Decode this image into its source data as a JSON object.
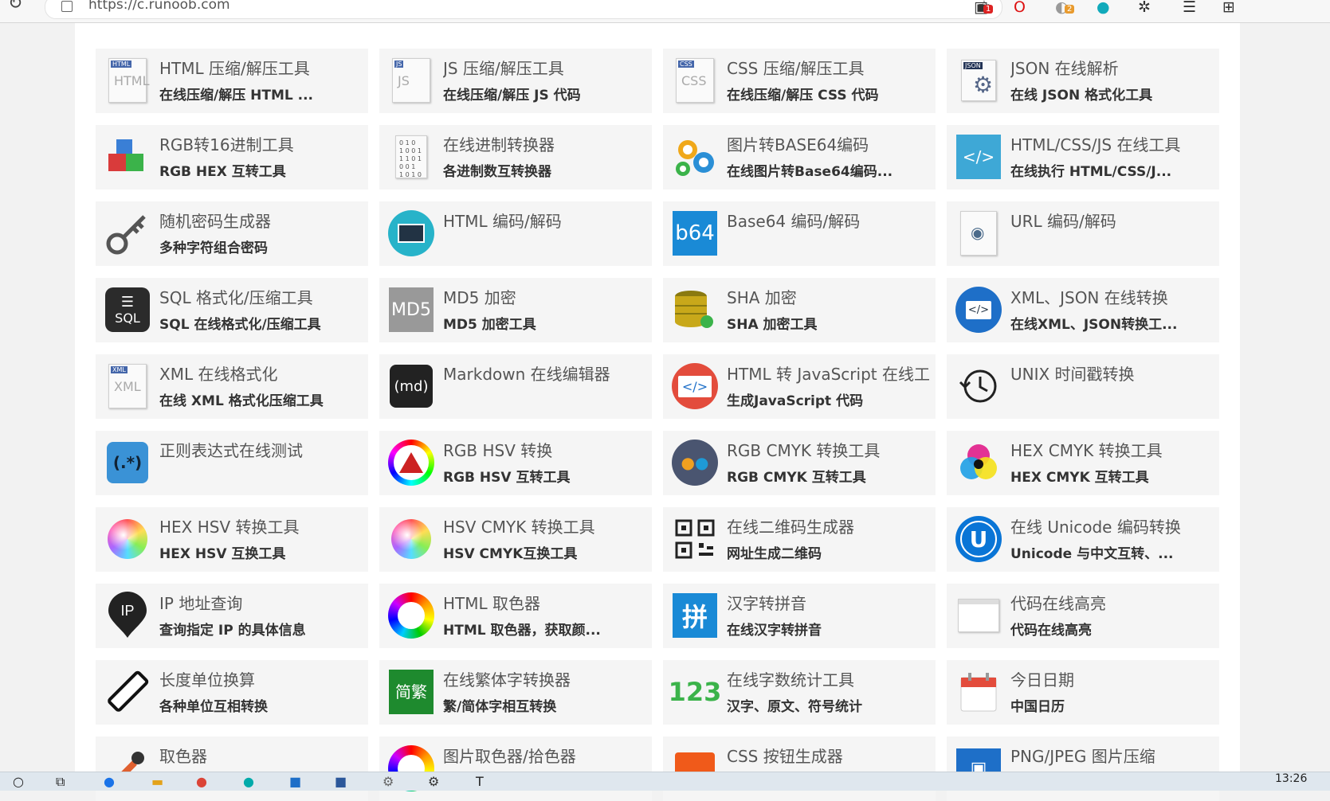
{
  "browser": {
    "url": "https://c.runoob.com",
    "badges": [
      "1",
      "2"
    ]
  },
  "tools": [
    {
      "title": "HTML 压缩/解压工具",
      "desc": "在线压缩/解压 HTML ...",
      "icon": "html-doc-icon",
      "icon_text": "HTML",
      "tag": "HTML"
    },
    {
      "title": "JS 压缩/解压工具",
      "desc": "在线压缩/解压 JS 代码",
      "icon": "js-doc-icon",
      "icon_text": "JS",
      "tag": "JS"
    },
    {
      "title": "CSS 压缩/解压工具",
      "desc": "在线压缩/解压 CSS 代码",
      "icon": "css-doc-icon",
      "icon_text": "CSS",
      "tag": "CSS"
    },
    {
      "title": "JSON 在线解析",
      "desc": "在线 JSON 格式化工具",
      "icon": "json-gear-icon",
      "icon_text": "JSON",
      "tag": ""
    },
    {
      "title": "RGB转16进制工具",
      "desc": "RGB HEX 互转工具",
      "icon": "rgb-cubes-icon",
      "icon_text": "",
      "tag": ""
    },
    {
      "title": "在线进制转换器",
      "desc": "各进制数互转换器",
      "icon": "binary-doc-icon",
      "icon_text": "",
      "tag": ""
    },
    {
      "title": "图片转BASE64编码",
      "desc": "在线图片转Base64编码...",
      "icon": "gears-icon",
      "icon_text": "",
      "tag": ""
    },
    {
      "title": "HTML/CSS/JS 在线工具",
      "desc": "在线执行 HTML/CSS/J...",
      "icon": "code-window-icon",
      "icon_text": "",
      "tag": ""
    },
    {
      "title": "随机密码生成器",
      "desc": "多种字符组合密码",
      "icon": "key-icon",
      "icon_text": "",
      "tag": ""
    },
    {
      "title": "HTML 编码/解码",
      "desc": "",
      "icon": "monitor-icon",
      "icon_text": "",
      "tag": ""
    },
    {
      "title": "Base64 编码/解码",
      "desc": "",
      "icon": "b64-icon",
      "icon_text": "b64",
      "tag": ""
    },
    {
      "title": "URL 编码/解码",
      "desc": "",
      "icon": "url-doc-icon",
      "icon_text": "",
      "tag": ""
    },
    {
      "title": "SQL 格式化/压缩工具",
      "desc": "SQL 在线格式化/压缩工具",
      "icon": "sql-icon",
      "icon_text": "SQL",
      "tag": ""
    },
    {
      "title": "MD5 加密",
      "desc": "MD5 加密工具",
      "icon": "md5-icon",
      "icon_text": "MD5",
      "tag": ""
    },
    {
      "title": "SHA 加密",
      "desc": "SHA 加密工具",
      "icon": "database-key-icon",
      "icon_text": "",
      "tag": ""
    },
    {
      "title": "XML、JSON 在线转换",
      "desc": "在线XML、JSON转换工...",
      "icon": "xml-json-icon",
      "icon_text": "",
      "tag": ""
    },
    {
      "title": "XML 在线格式化",
      "desc": "在线 XML 格式化压缩工具",
      "icon": "xml-doc-icon",
      "icon_text": "",
      "tag": "XML"
    },
    {
      "title": "Markdown 在线编辑器",
      "desc": "",
      "icon": "markdown-icon",
      "icon_text": "(md)",
      "tag": ""
    },
    {
      "title": "HTML 转 JavaScript 在线工具",
      "desc": "生成JavaScript 代码",
      "icon": "html-js-icon",
      "icon_text": "</>",
      "tag": ""
    },
    {
      "title": "UNIX 时间戳转换",
      "desc": "",
      "icon": "history-clock-icon",
      "icon_text": "",
      "tag": ""
    },
    {
      "title": "正则表达式在线测试",
      "desc": "",
      "icon": "regex-icon",
      "icon_text": "(.*)",
      "tag": ""
    },
    {
      "title": "RGB HSV 转换",
      "desc": "RGB HSV 互转工具",
      "icon": "color-triangle-icon",
      "icon_text": "",
      "tag": ""
    },
    {
      "title": "RGB CMYK 转换工具",
      "desc": "RGB CMYK 互转工具",
      "icon": "drops-icon",
      "icon_text": "",
      "tag": ""
    },
    {
      "title": "HEX CMYK 转换工具",
      "desc": "HEX CMYK 互转工具",
      "icon": "cmyk-circles-icon",
      "icon_text": "",
      "tag": ""
    },
    {
      "title": "HEX HSV 转换工具",
      "desc": "HEX HSV 互换工具",
      "icon": "color-ball-icon",
      "icon_text": "",
      "tag": ""
    },
    {
      "title": "HSV CMYK 转换工具",
      "desc": "HSV CMYK互换工具",
      "icon": "color-ball-icon",
      "icon_text": "",
      "tag": ""
    },
    {
      "title": "在线二维码生成器",
      "desc": "网址生成二维码",
      "icon": "qrcode-icon",
      "icon_text": "",
      "tag": ""
    },
    {
      "title": "在线 Unicode 编码转换",
      "desc": "Unicode 与中文互转、...",
      "icon": "unicode-icon",
      "icon_text": "U",
      "tag": ""
    },
    {
      "title": "IP 地址查询",
      "desc": "查询指定 IP 的具体信息",
      "icon": "ip-pin-icon",
      "icon_text": "IP",
      "tag": ""
    },
    {
      "title": "HTML 取色器",
      "desc": "HTML 取色器，获取颜...",
      "icon": "color-ring-icon",
      "icon_text": "",
      "tag": ""
    },
    {
      "title": "汉字转拼音",
      "desc": "在线汉字转拼音",
      "icon": "pinyin-icon",
      "icon_text": "拼",
      "tag": ""
    },
    {
      "title": "代码在线高亮",
      "desc": "代码在线高亮",
      "icon": "code-window-gray-icon",
      "icon_text": "",
      "tag": ""
    },
    {
      "title": "长度单位换算",
      "desc": "各种单位互相转换",
      "icon": "ruler-icon",
      "icon_text": "",
      "tag": ""
    },
    {
      "title": "在线繁体字转换器",
      "desc": "繁/简体字相互转换",
      "icon": "traditional-chinese-icon",
      "icon_text": "简繁",
      "tag": ""
    },
    {
      "title": "在线字数统计工具",
      "desc": "汉字、原文、符号统计",
      "icon": "number-123-icon",
      "icon_text": "123",
      "tag": ""
    },
    {
      "title": "今日日期",
      "desc": "中国日历",
      "icon": "calendar-icon",
      "icon_text": "",
      "tag": ""
    },
    {
      "title": "取色器",
      "desc": "",
      "icon": "eyedropper-icon",
      "icon_text": "",
      "tag": ""
    },
    {
      "title": "图片取色器/拾色器",
      "desc": "",
      "icon": "color-ring-icon",
      "icon_text": "",
      "tag": ""
    },
    {
      "title": "CSS 按钮生成器",
      "desc": "",
      "icon": "css-button-icon",
      "icon_text": "",
      "tag": ""
    },
    {
      "title": "PNG/JPEG 图片压缩",
      "desc": "",
      "icon": "image-compress-icon",
      "icon_text": "",
      "tag": ""
    }
  ],
  "taskbar": {
    "clock": "13:26"
  }
}
